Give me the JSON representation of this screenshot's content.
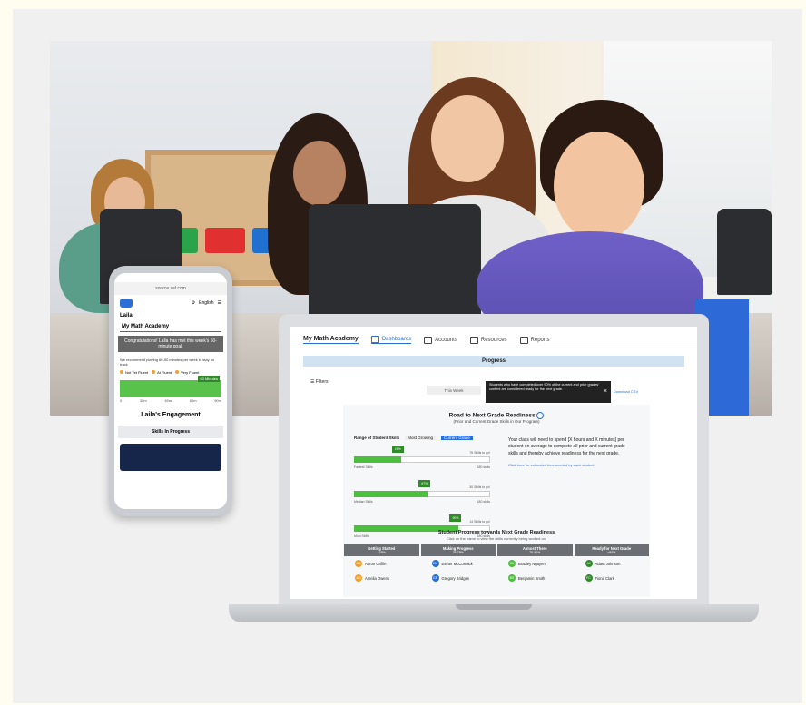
{
  "colors": {
    "brand_blue": "#2b6fd6",
    "progress_green": "#4cbf3f",
    "flag_green": "#2f8a2a",
    "orange": "#f0a030",
    "column_header_gray": "#6b6f74"
  },
  "phone": {
    "url": "source.sel.com",
    "header_right_text": "English",
    "student_name": "Laila",
    "academy": "My Math Academy",
    "banner": "Congratulations! Laila has met this week's 60-minute goal.",
    "note": "We recommend playing 60-90 minutes per week to stay on track",
    "legend": [
      "Not Yet Fluent",
      "At Fluent",
      "Very Fluent"
    ],
    "bar_label": "60 Minutes",
    "ticks": [
      "0",
      "30m",
      "45m",
      "60m",
      "90m"
    ],
    "engagement_title": "Laila's Engagement",
    "skills_title": "Skills In Progress"
  },
  "laptop": {
    "brand": "My Math Academy",
    "tabs": [
      {
        "label": "Dashboards",
        "icon": "dashboard-icon"
      },
      {
        "label": "Accounts",
        "icon": "accounts-icon"
      },
      {
        "label": "Resources",
        "icon": "resources-icon"
      },
      {
        "label": "Reports",
        "icon": "reports-icon"
      }
    ],
    "progress_header": "Progress",
    "filters_label": "Filters",
    "this_week": "This Week",
    "tooltip": "Students who have completed over 90% of the current and prior grades' content are considered ready for the next grade.",
    "download": "Download CSV",
    "road_title": "Road to Next Grade Readiness",
    "road_subtitle": "(Prior and Current Grade Skills in Our Program)",
    "range_label": "Range of Student Skills",
    "toggle_options": [
      "Most Growing",
      "Current Grade"
    ],
    "bars": [
      {
        "flag": "25%",
        "fill": 0.35,
        "right_top": "75 Skills to go!",
        "left_bottom": "Fastest Skills",
        "right_bottom": "180 skills"
      },
      {
        "flag": "67%",
        "fill": 0.55,
        "right_top": "30 Skills to go!",
        "left_bottom": "Median Skills",
        "right_bottom": "180 skills"
      },
      {
        "flag": "90%",
        "fill": 0.78,
        "right_top": "14 Skills to go!",
        "left_bottom": "Most Skills",
        "right_bottom": "180 skills"
      }
    ],
    "summary": "Your class will need to spend [X hours and X minutes] per student on average to complete all prior and current grade skills and thereby achieve readiness for the next grade.",
    "summary_link": "Click here for estimated time needed by each student",
    "student_progress_title": "Student Progress towards Next Grade Readiness",
    "student_progress_sub": "Click on the name to view the skills currently being worked on.",
    "columns": [
      {
        "title": "Getting Started",
        "sub": "<25%",
        "color": "#f0a030",
        "students": [
          {
            "initials": "AG",
            "name": "Aaron Griffin"
          },
          {
            "initials": "AO",
            "name": "Amelia Owens"
          }
        ]
      },
      {
        "title": "Making Progress",
        "sub": "25-75%",
        "color": "#2b6fd6",
        "students": [
          {
            "initials": "EM",
            "name": "Esther McCormick"
          },
          {
            "initials": "GB",
            "name": "Gregory Bridges"
          }
        ]
      },
      {
        "title": "Almost There",
        "sub": "75-90%",
        "color": "#4cbf3f",
        "students": [
          {
            "initials": "BN",
            "name": "Bradley Nguyen"
          },
          {
            "initials": "BS",
            "name": "Benjamin Smith"
          }
        ]
      },
      {
        "title": "Ready for Next Grade",
        "sub": ">90%",
        "color": "#2f8a2a",
        "students": [
          {
            "initials": "AJ",
            "name": "Adam Johnson"
          },
          {
            "initials": "FC",
            "name": "Fiona Clark"
          }
        ]
      }
    ]
  }
}
